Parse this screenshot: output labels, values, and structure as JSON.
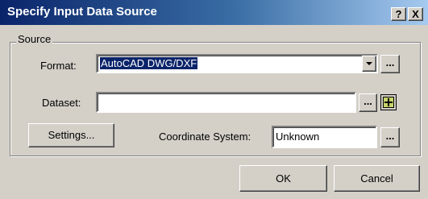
{
  "window": {
    "title": "Specify Input Data Source",
    "help_button": "?",
    "close_button": "X"
  },
  "source": {
    "group_label": "Source",
    "format_label": "Format:",
    "format_value": "AutoCAD DWG/DXF",
    "format_browse": "...",
    "dataset_label": "Dataset:",
    "dataset_value": "",
    "dataset_browse": "...",
    "settings_button": "Settings...",
    "coord_label": "Coordinate System:",
    "coord_value": "Unknown",
    "coord_browse": "..."
  },
  "footer": {
    "ok": "OK",
    "cancel": "Cancel"
  },
  "icons": {
    "format_dropdown": "chevron-down-icon",
    "dataset_add": "plus-icon"
  },
  "colors": {
    "title_start": "#0a246a",
    "title_end": "#a6caf0",
    "selection": "#0a246a",
    "face": "#d4d0c8"
  }
}
